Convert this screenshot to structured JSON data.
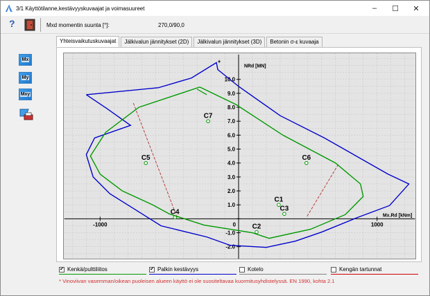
{
  "window": {
    "title": "3/1 Käyttötilanne,kestävyyskuvaajat ja voimasuureet",
    "controls": {
      "minimize": "–",
      "maximize": "☐",
      "close": "✕"
    }
  },
  "toolbar": {
    "help_label": "?",
    "direction_label": "Mxd momentin suunta [°]:",
    "direction_value": "270,0/90,0"
  },
  "tabs": [
    {
      "label": "Yhteisvaikutuskuvaajat",
      "active": true
    },
    {
      "label": "Jälkivalun jännitykset (2D)",
      "active": false
    },
    {
      "label": "Jälkivalun jännitykset (3D)",
      "active": false
    },
    {
      "label": "Betonin σ-ε kuvaaja",
      "active": false
    }
  ],
  "sidebar": {
    "buttons": [
      {
        "label": "Mx"
      },
      {
        "label": "My"
      },
      {
        "label": "Mxy"
      }
    ]
  },
  "chart_data": {
    "type": "scatter",
    "xlabel": "Mx.Rd [kNm]",
    "ylabel": "NRd [MN]",
    "xlim": [
      -1230,
      1230
    ],
    "ylim": [
      -2.6,
      11.5
    ],
    "x_ticks": [
      -1000,
      0,
      1000
    ],
    "y_ticks": [
      -2,
      -1,
      0,
      1,
      2,
      3,
      4,
      5,
      6,
      7,
      8,
      9,
      10
    ],
    "grid": true,
    "colors": {
      "blue": "#0000cc",
      "green": "#009900",
      "dash": "#b03030"
    },
    "curves": [
      {
        "name": "Palkin kestävyys",
        "color": "#0000cc",
        "points": [
          [
            -1100,
            8.9
          ],
          [
            -950,
            7.9
          ],
          [
            -780,
            6.7
          ],
          [
            -1040,
            5.8
          ],
          [
            -1100,
            4.6
          ],
          [
            -1050,
            3.0
          ],
          [
            -930,
            1.8
          ],
          [
            -760,
            0.75
          ],
          [
            -560,
            -0.5
          ],
          [
            -230,
            -1.3
          ],
          [
            -60,
            -1.9
          ],
          [
            200,
            -2.05
          ],
          [
            410,
            -1.6
          ],
          [
            600,
            -0.95
          ],
          [
            860,
            0.1
          ],
          [
            1090,
            0.95
          ],
          [
            1230,
            2.5
          ],
          [
            1080,
            3.2
          ],
          [
            620,
            5.8
          ],
          [
            300,
            7.4
          ],
          [
            0,
            9.5
          ],
          [
            -150,
            10.7
          ],
          [
            -160,
            11.2
          ],
          [
            -340,
            10.1
          ],
          [
            -580,
            9.4
          ],
          [
            -1100,
            8.9
          ]
        ]
      },
      {
        "name": "Kenkä/pulttiliitos",
        "color": "#009900",
        "points": [
          [
            -280,
            9.45
          ],
          [
            -720,
            8.0
          ],
          [
            -960,
            6.2
          ],
          [
            -1070,
            4.5
          ],
          [
            -1000,
            3.2
          ],
          [
            -840,
            2.0
          ],
          [
            -620,
            1.0
          ],
          [
            -500,
            0.35
          ],
          [
            -250,
            -0.45
          ],
          [
            100,
            -1.0
          ],
          [
            220,
            -1.4
          ],
          [
            520,
            -0.75
          ],
          [
            770,
            0.3
          ],
          [
            900,
            1.6
          ],
          [
            880,
            2.5
          ],
          [
            700,
            4.0
          ],
          [
            320,
            6.0
          ],
          [
            -20,
            8.2
          ],
          [
            -280,
            9.45
          ]
        ]
      }
    ],
    "arrow": {
      "from": [
        -300,
        9.3
      ],
      "to": [
        -230,
        8.9
      ]
    },
    "dashed_lines": [
      {
        "from": [
          -760,
          8.3
        ],
        "to": [
          -440,
          0.0
        ]
      },
      {
        "from": [
          720,
          3.9
        ],
        "to": [
          490,
          0.1
        ]
      }
    ],
    "points": [
      {
        "label": "C1",
        "x": 290,
        "y": 1.0
      },
      {
        "label": "C2",
        "x": 130,
        "y": -0.95
      },
      {
        "label": "C3",
        "x": 330,
        "y": 0.35
      },
      {
        "label": "C4",
        "x": -460,
        "y": 0.1
      },
      {
        "label": "C5",
        "x": -670,
        "y": 4.0
      },
      {
        "label": "C6",
        "x": 490,
        "y": 4.0
      },
      {
        "label": "C7",
        "x": -220,
        "y": 7.0
      }
    ]
  },
  "legend": [
    {
      "label": "Kenkä/pulttiliitos",
      "checked": true,
      "color": "#009900"
    },
    {
      "label": "Palkin kestävyys",
      "checked": true,
      "color": "#0000cc"
    },
    {
      "label": "Kotelo",
      "checked": false,
      "color": "#808080"
    },
    {
      "label": "Kengän tartunnat",
      "checked": false,
      "color": "#cc0000"
    }
  ],
  "note": "* Vinoviivan vasemman/oikean puoleisen alueen käyttö ei ole suositeltavaa kuormitusyhdistelyssä. EN 1990, kohta 2.1"
}
